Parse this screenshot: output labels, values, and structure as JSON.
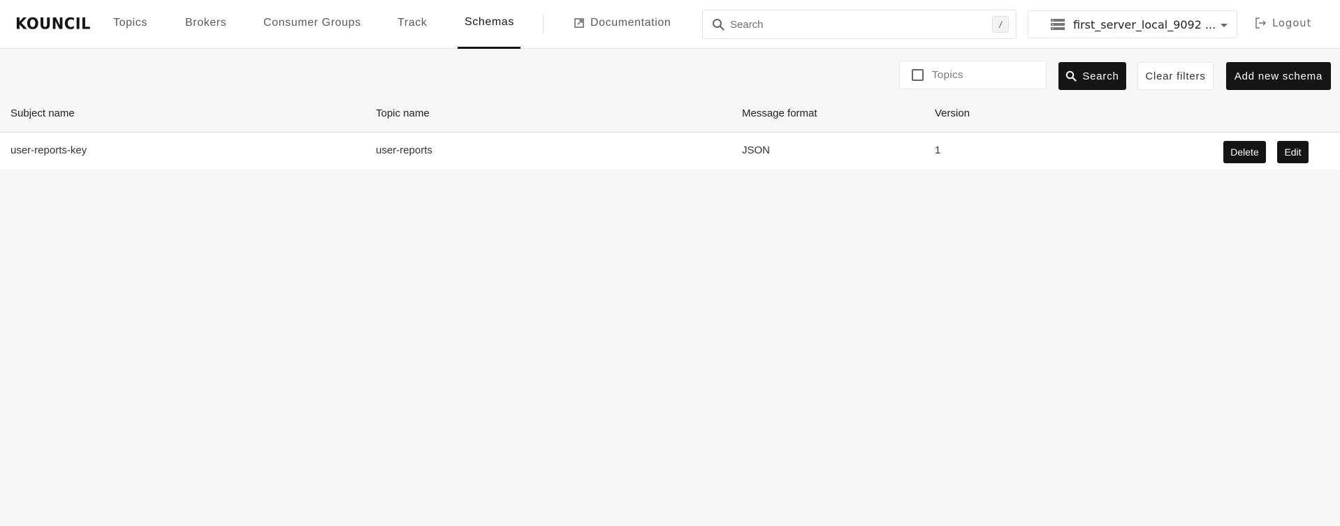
{
  "app": {
    "logo": "KOUNCIL"
  },
  "nav": {
    "items": [
      {
        "label": "Topics",
        "active": false
      },
      {
        "label": "Brokers",
        "active": false
      },
      {
        "label": "Consumer Groups",
        "active": false
      },
      {
        "label": "Track",
        "active": false
      },
      {
        "label": "Schemas",
        "active": true
      }
    ],
    "documentation": {
      "label": "Documentation",
      "icon": "external-link-icon"
    },
    "search": {
      "placeholder": "Search",
      "value": "",
      "shortcut": "/",
      "icon": "search-icon"
    },
    "server_select": {
      "value": "first_server_local_9092 ...",
      "icon": "server-icon"
    },
    "logout": {
      "label": "Logout",
      "icon": "logout-icon"
    }
  },
  "toolbar": {
    "topics_filter": {
      "label": "Topics",
      "checked": false
    },
    "search_button": {
      "label": "Search",
      "icon": "search-icon"
    },
    "clear_filters_button": {
      "label": "Clear filters"
    },
    "add_schema_button": {
      "label": "Add new schema"
    }
  },
  "table": {
    "columns": [
      "Subject name",
      "Topic name",
      "Message format",
      "Version"
    ],
    "rows": [
      {
        "subject": "user-reports-key",
        "topic": "user-reports",
        "format": "JSON",
        "version": "1",
        "actions": {
          "delete": "Delete",
          "edit": "Edit"
        }
      }
    ]
  }
}
